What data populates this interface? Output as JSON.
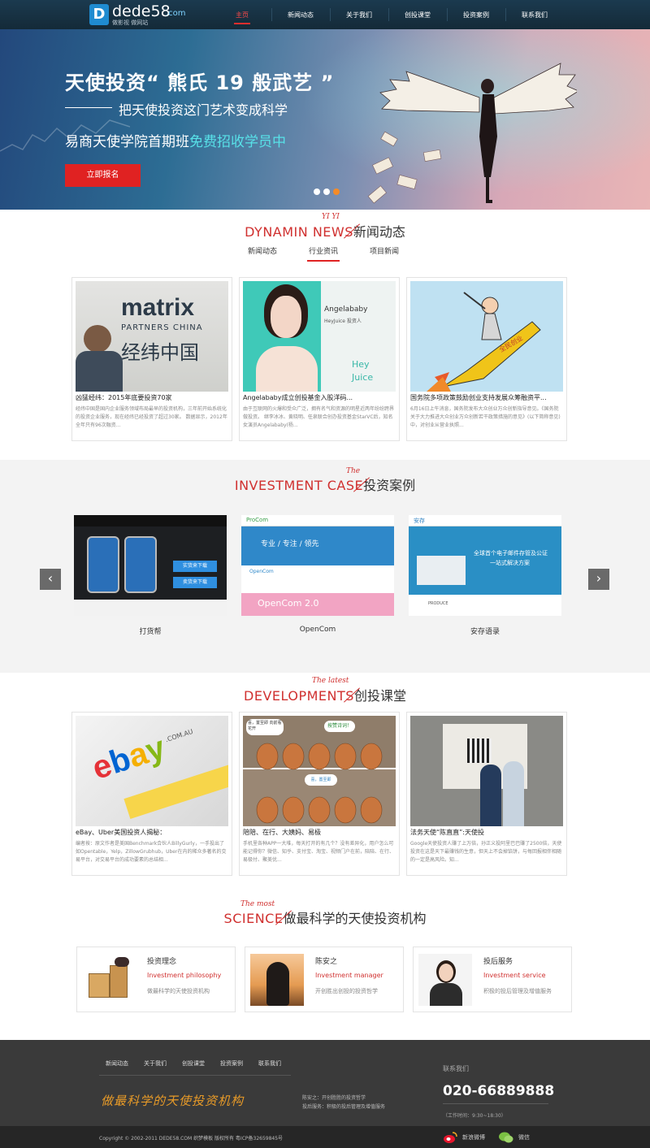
{
  "header": {
    "logo_text": "dede58",
    "logo_domain": ".com",
    "logo_mark": "D",
    "logo_slogan": "做影视 做网站",
    "nav": [
      "主页",
      "新闻动态",
      "关于我们",
      "创投课堂",
      "投资案例",
      "联系我们"
    ],
    "active_nav": "主页"
  },
  "banner": {
    "headline": "天使投资“ 熊氏 19 般武艺 ”",
    "subline": "把天使投资这门艺术变成科学",
    "line3_prefix": "易商天使学院首期班",
    "line3_highlight": "免费招收学员中",
    "button": "立即报名",
    "slides": 3,
    "active_slide": 3
  },
  "news": {
    "title_en": "DYNAMIN NEWS",
    "title_small": "YI YI",
    "title_cn": "新闻动态",
    "tabs": [
      "新闻动态",
      "行业资讯",
      "项目新闻"
    ],
    "active_tab": "行业资讯",
    "items": [
      {
        "title": "凶猛经纬：2015年底要投资70家",
        "desc": "经纬中国是国内企业服务领域布局最早的投资机构，三年前开始系统化的投资企业服务，现在经纬已经投资了超过30家。 数据显示，2012年全年只有96次融资...",
        "img_text_1": "matrix",
        "img_text_2": "PARTNERS CHINA",
        "img_text_3": "经纬中国"
      },
      {
        "title": "Angelababy成立创投基金入股洋码...",
        "desc": "由于互联网的火爆和受众广泛，拥有名气和资源的明星近两年纷纷跨界做投资。 继李冰冰、黄晓明、任泉联合创办投资基金StarVC后，知名女演员Angelababy(杨...",
        "img_text_1": "Angelababy",
        "img_text_2": "HeyJuice 投资人",
        "img_text_3": "Hey",
        "img_text_4": "Juice"
      },
      {
        "title": "国务院多项政策鼓励创业支持发展众筹融资平...",
        "desc": "6月16日上午消息，国务院发布大众创业万众创新指导意见。《国务院关于大力推进大众创业万众创新若干政策措施的意见》(以下简称意见)中，对创业从营业执照...",
        "img_text_1": "全民创业"
      }
    ]
  },
  "cases": {
    "title_en": "INVESTMENT CASE",
    "title_small": "The",
    "title_cn": "投资案例",
    "items": [
      {
        "name": "打货帮",
        "screen_1": "实货来下载",
        "screen_2": "卖货来下载"
      },
      {
        "name": "OpenCom",
        "brand": "ProCom",
        "screen_1": "专业 / 专注 / 领先",
        "screen_2": "OpenCom",
        "screen_3": "OpenCom 2.0"
      },
      {
        "name": "安存语录",
        "brand": "安存",
        "screen_1": "全球首个电子邮件存管及公证",
        "screen_2": "一站式解决方案",
        "screen_3": "PRODUCE"
      }
    ],
    "prev_icon": "chevron-left-icon",
    "next_icon": "chevron-right-icon"
  },
  "developments": {
    "title_en": "DEVELOPMENTS",
    "title_small": "The latest",
    "title_cn": "创投课堂",
    "items": [
      {
        "title": "eBay、Uber美国投资人揭秘：",
        "desc": "编者按：原文作者是美国Benchmark合伙人BillyGurly，一手投出了如Opentable，Yelp，ZillowGrubhub，Uber在内的稀众多著名的交易平台，对交易平台的成功要素的总结相...",
        "img_text": "eBay",
        "img_text_2": ".COM.AU"
      },
      {
        "title": "陪陪、在行、大姨妈、易极",
        "desc": "手机里各种APP一大堆，每天打开的有几个？没有差异化，用户怎么可能记得你？微信、知乎、支付宝、淘宝、视频门户在前，陪陪、在行、易极付、聚美优...",
        "bubble_1": "喜，置至即 向前看花开",
        "bubble_2": "按赞诗词！",
        "bubble_3": "喜，置至即"
      },
      {
        "title": "法务天使“陈直直”:天使投",
        "desc": "Google天使投资人赚了上万倍，孙正义投阿里巴巴赚了2500倍，天使投资在这是天下最赚钱的生意，但天上不会掉馅饼，与每回报相伴相随的一定是高风险。知..."
      }
    ]
  },
  "science": {
    "title_en": "SCIENCE",
    "title_small": "The most",
    "title_cn": "做最科学的天使投资机构",
    "items": [
      {
        "cn": "投资理念",
        "en": "Investment philosophy",
        "desc": "做最科学的天使投资机构"
      },
      {
        "cn": "陈安之",
        "en": "Investment manager",
        "desc": "开创胜出创投的投资哲学"
      },
      {
        "cn": "投后服务",
        "en": "Investment service",
        "desc": "积极的投后管理及增值服务"
      }
    ]
  },
  "footer": {
    "nav": [
      "新闻动态",
      "关于我们",
      "创投课堂",
      "投资案例",
      "联系我们"
    ],
    "slogan": "做最科学的天使投资机构",
    "info_1": "陈安之：开创胜胜的投资哲学",
    "info_2": "投后服务：积极的投后管理及增值服务",
    "contact_label": "联系我们",
    "phone": "020-66889888",
    "hours": "（工作时间：9:30~18:30）",
    "copyright": "Copyright © 2002-2011 DEDE58.COM 织梦模板 版权所有 粤ICP备32659845号",
    "weibo": "新浪微博",
    "wechat": "微信"
  },
  "colors": {
    "accent": "#d0302f",
    "header": "#17313f",
    "footer": "#3a3a3a",
    "banner_button": "#e02222",
    "highlight": "#58e1e8"
  }
}
